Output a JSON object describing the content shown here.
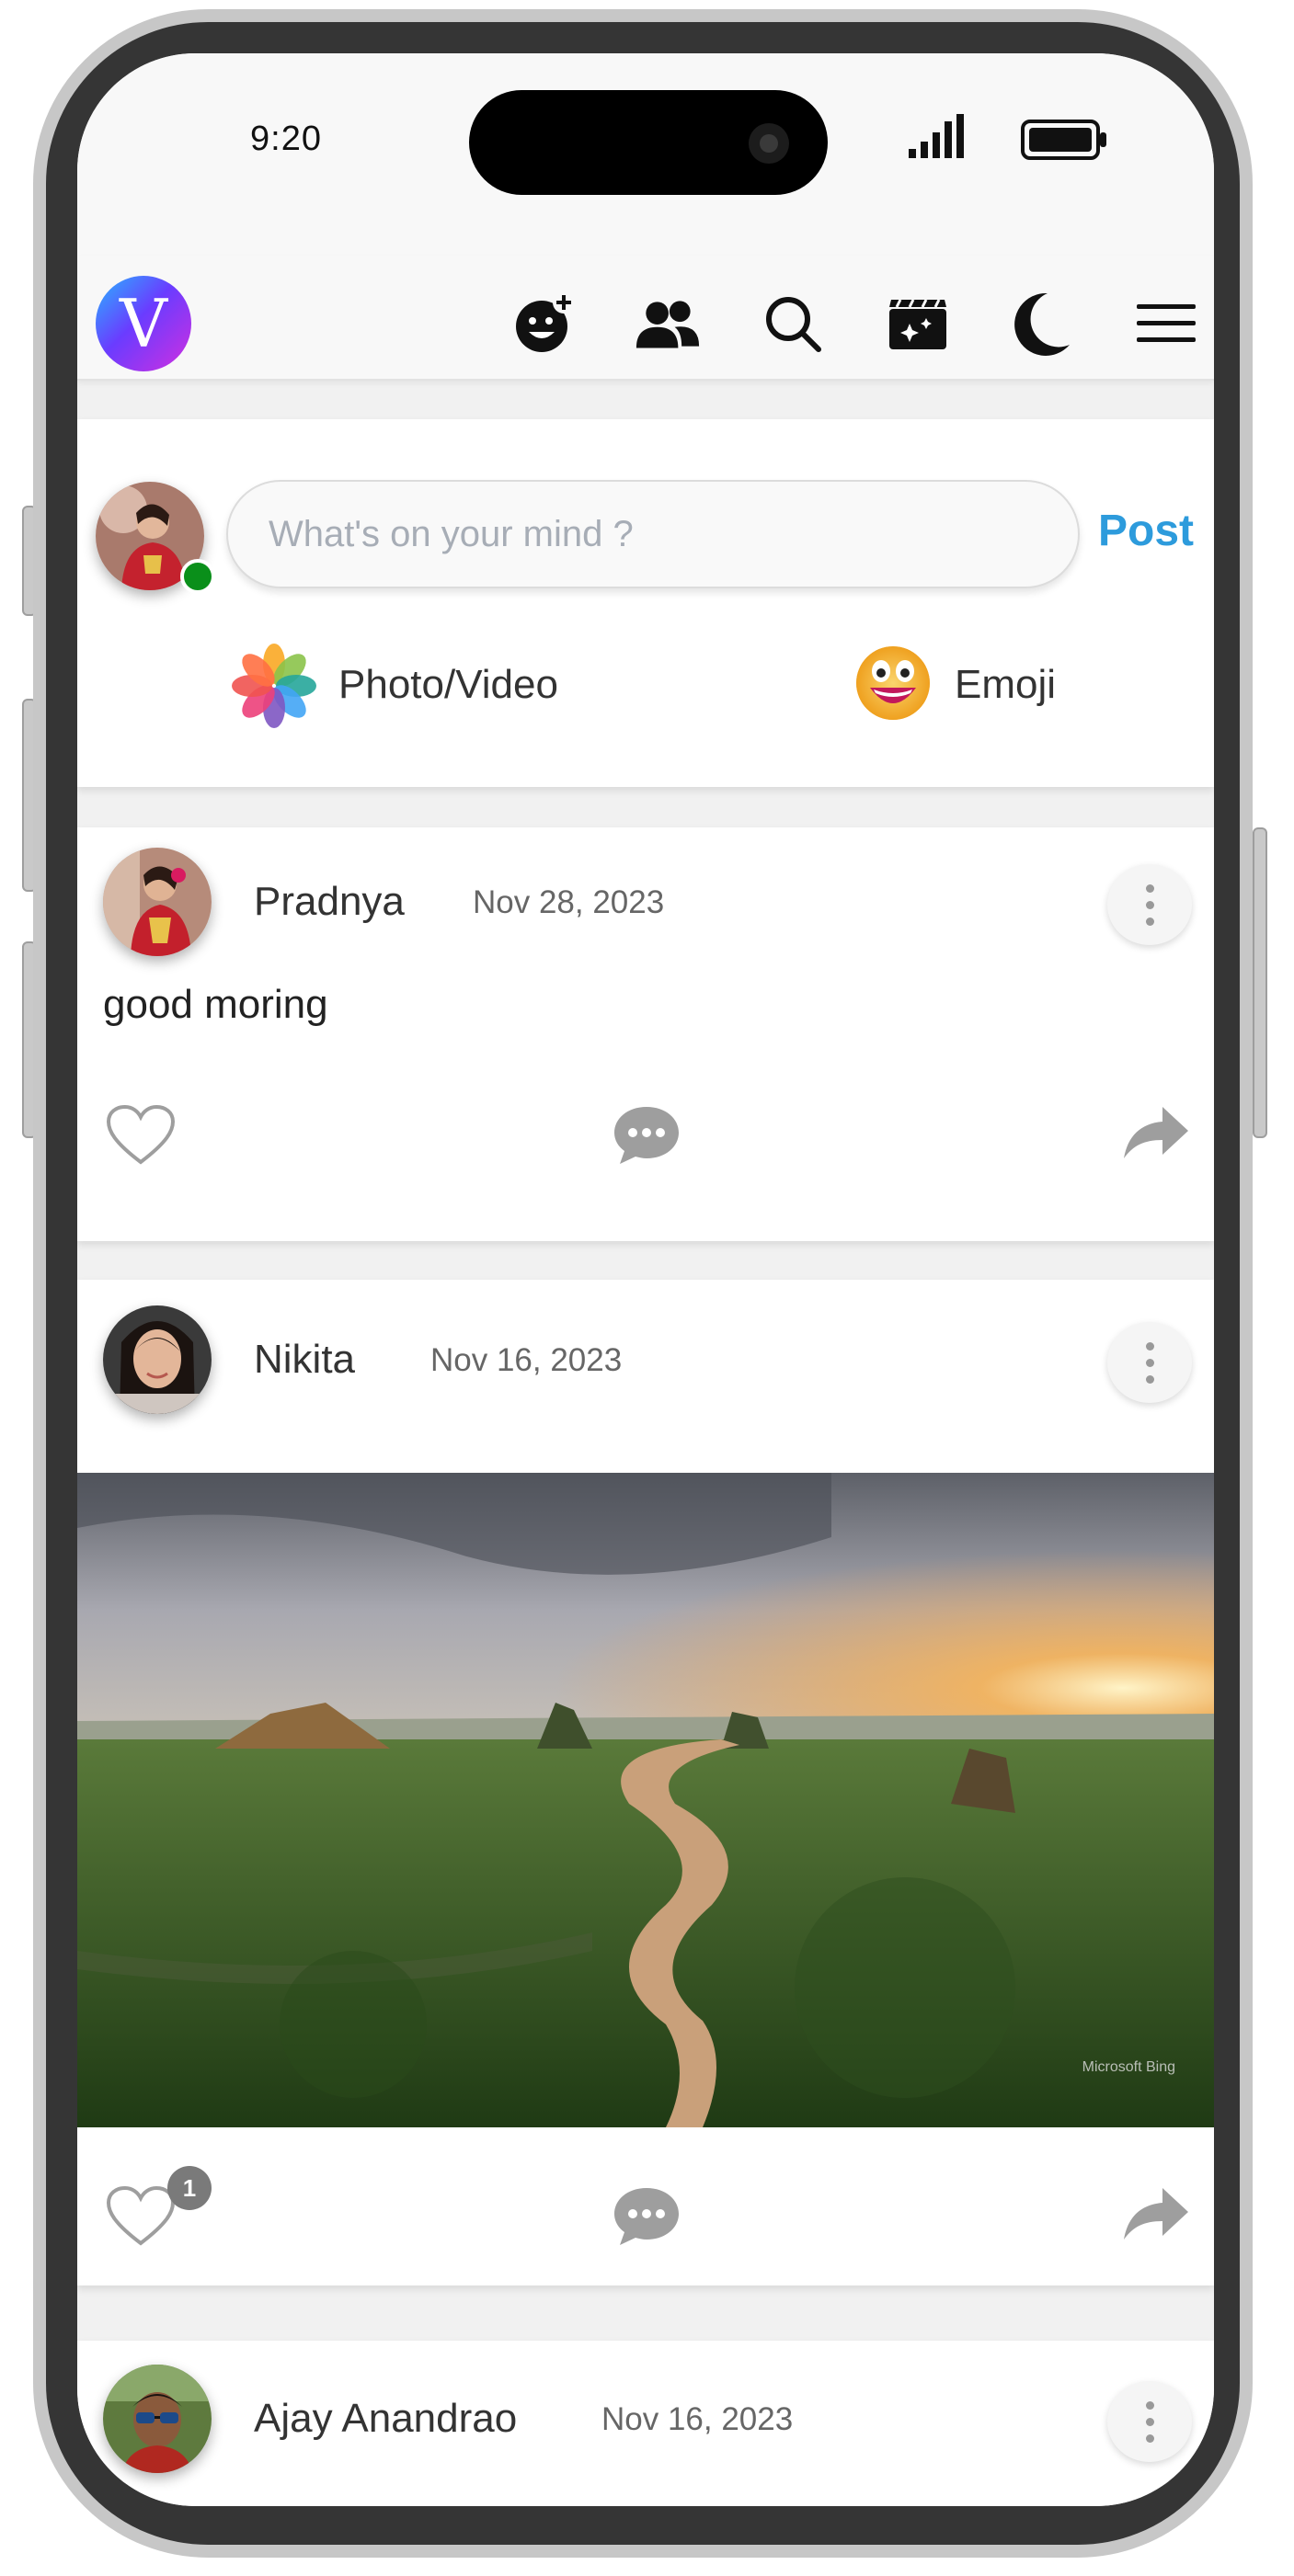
{
  "status_bar": {
    "time": "9:20"
  },
  "app": {
    "logo_letter": "V",
    "nav_icons": [
      "add-friend-emoji-icon",
      "friends-icon",
      "search-icon",
      "reels-icon",
      "dark-mode-moon-icon",
      "menu-hamburger-icon"
    ]
  },
  "composer": {
    "placeholder": "What's on your mind ?",
    "post_label": "Post",
    "photo_video_label": "Photo/Video",
    "emoji_label": "Emoji"
  },
  "posts": [
    {
      "author": "Pradnya",
      "date": "Nov 28, 2023",
      "text": "good moring",
      "likes": ""
    },
    {
      "author": "Nikita",
      "date": "Nov 16, 2023",
      "image_watermark": "Microsoft Bing",
      "likes": "1"
    },
    {
      "author": "Ajay Anandrao",
      "date": "Nov 16, 2023"
    }
  ],
  "colors": {
    "accent": "#2d9bdc",
    "online": "#0a8f1a",
    "icon_grey": "#9e9e9e"
  }
}
